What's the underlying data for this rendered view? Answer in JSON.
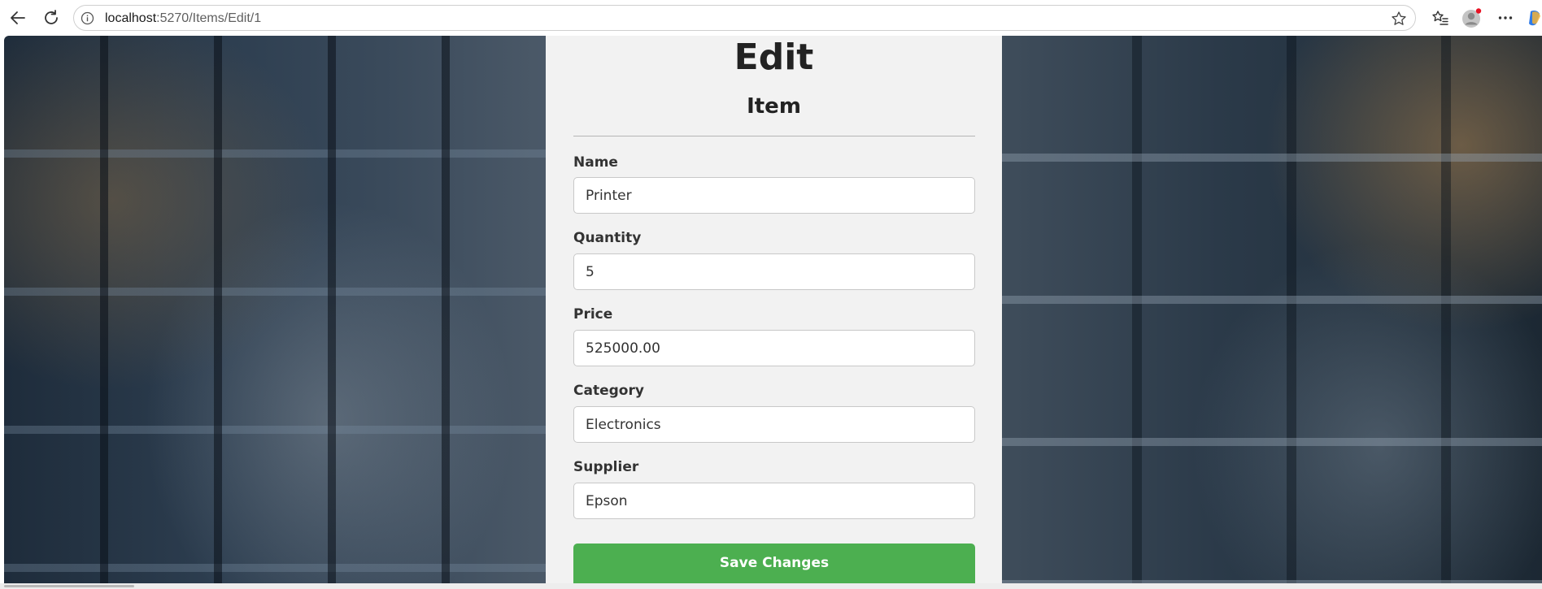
{
  "browser": {
    "url_host": "localhost",
    "url_path": ":5270/Items/Edit/1",
    "icons": {
      "back": "arrow-left-icon",
      "reload": "reload-icon",
      "info": "info-circle-icon",
      "star": "star-icon",
      "favorites": "favorites-icon",
      "profile": "profile-icon",
      "more": "more-icon",
      "copilot": "copilot-icon"
    }
  },
  "form": {
    "title": "Edit",
    "subtitle": "Item",
    "fields": [
      {
        "label": "Name",
        "value": "Printer"
      },
      {
        "label": "Quantity",
        "value": "5"
      },
      {
        "label": "Price",
        "value": "525000.00"
      },
      {
        "label": "Category",
        "value": "Electronics"
      },
      {
        "label": "Supplier",
        "value": "Epson"
      }
    ],
    "save_label": "Save Changes"
  },
  "colors": {
    "accent": "#4caf50",
    "panel_bg": "#f2f2f2",
    "profile_badge": "#e81123"
  }
}
